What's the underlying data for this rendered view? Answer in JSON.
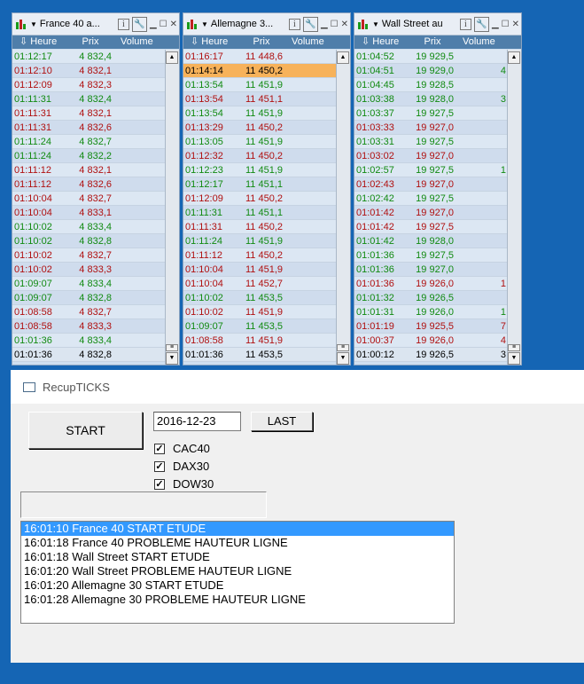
{
  "panels": [
    {
      "title": "France 40 a...",
      "columns": [
        "Heure",
        "Prix",
        "Volume"
      ],
      "rows": [
        {
          "time": "01:12:17",
          "price": "4 832,4",
          "volume": "",
          "dir": "up"
        },
        {
          "time": "01:12:10",
          "price": "4 832,1",
          "volume": "",
          "dir": "down"
        },
        {
          "time": "01:12:09",
          "price": "4 832,3",
          "volume": "",
          "dir": "down"
        },
        {
          "time": "01:11:31",
          "price": "4 832,4",
          "volume": "",
          "dir": "up"
        },
        {
          "time": "01:11:31",
          "price": "4 832,1",
          "volume": "",
          "dir": "down"
        },
        {
          "time": "01:11:31",
          "price": "4 832,6",
          "volume": "",
          "dir": "down"
        },
        {
          "time": "01:11:24",
          "price": "4 832,7",
          "volume": "",
          "dir": "up"
        },
        {
          "time": "01:11:24",
          "price": "4 832,2",
          "volume": "",
          "dir": "up"
        },
        {
          "time": "01:11:12",
          "price": "4 832,1",
          "volume": "",
          "dir": "down"
        },
        {
          "time": "01:11:12",
          "price": "4 832,6",
          "volume": "",
          "dir": "down"
        },
        {
          "time": "01:10:04",
          "price": "4 832,7",
          "volume": "",
          "dir": "down"
        },
        {
          "time": "01:10:04",
          "price": "4 833,1",
          "volume": "",
          "dir": "down"
        },
        {
          "time": "01:10:02",
          "price": "4 833,4",
          "volume": "",
          "dir": "up"
        },
        {
          "time": "01:10:02",
          "price": "4 832,8",
          "volume": "",
          "dir": "up"
        },
        {
          "time": "01:10:02",
          "price": "4 832,7",
          "volume": "",
          "dir": "down"
        },
        {
          "time": "01:10:02",
          "price": "4 833,3",
          "volume": "",
          "dir": "down"
        },
        {
          "time": "01:09:07",
          "price": "4 833,4",
          "volume": "",
          "dir": "up"
        },
        {
          "time": "01:09:07",
          "price": "4 832,8",
          "volume": "",
          "dir": "up"
        },
        {
          "time": "01:08:58",
          "price": "4 832,7",
          "volume": "",
          "dir": "down"
        },
        {
          "time": "01:08:58",
          "price": "4 833,3",
          "volume": "",
          "dir": "down"
        },
        {
          "time": "01:01:36",
          "price": "4 833,4",
          "volume": "",
          "dir": "up"
        },
        {
          "time": "01:01:36",
          "price": "4 832,8",
          "volume": "",
          "dir": "last"
        }
      ]
    },
    {
      "title": "Allemagne 3...",
      "columns": [
        "Heure",
        "Prix",
        "Volume"
      ],
      "rows": [
        {
          "time": "01:16:17",
          "price": "11 448,6",
          "volume": "",
          "dir": "down"
        },
        {
          "time": "01:14:14",
          "price": "11 450,2",
          "volume": "",
          "dir": "sel"
        },
        {
          "time": "01:13:54",
          "price": "11 451,9",
          "volume": "",
          "dir": "up"
        },
        {
          "time": "01:13:54",
          "price": "11 451,1",
          "volume": "",
          "dir": "down"
        },
        {
          "time": "01:13:54",
          "price": "11 451,9",
          "volume": "",
          "dir": "up"
        },
        {
          "time": "01:13:29",
          "price": "11 450,2",
          "volume": "",
          "dir": "down"
        },
        {
          "time": "01:13:05",
          "price": "11 451,9",
          "volume": "",
          "dir": "up"
        },
        {
          "time": "01:12:32",
          "price": "11 450,2",
          "volume": "",
          "dir": "down"
        },
        {
          "time": "01:12:23",
          "price": "11 451,9",
          "volume": "",
          "dir": "up"
        },
        {
          "time": "01:12:17",
          "price": "11 451,1",
          "volume": "",
          "dir": "up"
        },
        {
          "time": "01:12:09",
          "price": "11 450,2",
          "volume": "",
          "dir": "down"
        },
        {
          "time": "01:11:31",
          "price": "11 451,1",
          "volume": "",
          "dir": "up"
        },
        {
          "time": "01:11:31",
          "price": "11 450,2",
          "volume": "",
          "dir": "down"
        },
        {
          "time": "01:11:24",
          "price": "11 451,9",
          "volume": "",
          "dir": "up"
        },
        {
          "time": "01:11:12",
          "price": "11 450,2",
          "volume": "",
          "dir": "down"
        },
        {
          "time": "01:10:04",
          "price": "11 451,9",
          "volume": "",
          "dir": "down"
        },
        {
          "time": "01:10:04",
          "price": "11 452,7",
          "volume": "",
          "dir": "down"
        },
        {
          "time": "01:10:02",
          "price": "11 453,5",
          "volume": "",
          "dir": "up"
        },
        {
          "time": "01:10:02",
          "price": "11 451,9",
          "volume": "",
          "dir": "down"
        },
        {
          "time": "01:09:07",
          "price": "11 453,5",
          "volume": "",
          "dir": "up"
        },
        {
          "time": "01:08:58",
          "price": "11 451,9",
          "volume": "",
          "dir": "down"
        },
        {
          "time": "01:01:36",
          "price": "11 453,5",
          "volume": "",
          "dir": "last"
        }
      ]
    },
    {
      "title": "Wall Street au c...",
      "columns": [
        "Heure",
        "Prix",
        "Volume"
      ],
      "rows": [
        {
          "time": "01:04:52",
          "price": "19 929,5",
          "volume": "",
          "dir": "up"
        },
        {
          "time": "01:04:51",
          "price": "19 929,0",
          "volume": "4",
          "dir": "up"
        },
        {
          "time": "01:04:45",
          "price": "19 928,5",
          "volume": "",
          "dir": "up"
        },
        {
          "time": "01:03:38",
          "price": "19 928,0",
          "volume": "3",
          "dir": "up"
        },
        {
          "time": "01:03:37",
          "price": "19 927,5",
          "volume": "",
          "dir": "up"
        },
        {
          "time": "01:03:33",
          "price": "19 927,0",
          "volume": "",
          "dir": "down"
        },
        {
          "time": "01:03:31",
          "price": "19 927,5",
          "volume": "",
          "dir": "up"
        },
        {
          "time": "01:03:02",
          "price": "19 927,0",
          "volume": "",
          "dir": "down"
        },
        {
          "time": "01:02:57",
          "price": "19 927,5",
          "volume": "1",
          "dir": "up"
        },
        {
          "time": "01:02:43",
          "price": "19 927,0",
          "volume": "",
          "dir": "down"
        },
        {
          "time": "01:02:42",
          "price": "19 927,5",
          "volume": "",
          "dir": "up"
        },
        {
          "time": "01:01:42",
          "price": "19 927,0",
          "volume": "",
          "dir": "down"
        },
        {
          "time": "01:01:42",
          "price": "19 927,5",
          "volume": "",
          "dir": "down"
        },
        {
          "time": "01:01:42",
          "price": "19 928,0",
          "volume": "",
          "dir": "up"
        },
        {
          "time": "01:01:36",
          "price": "19 927,5",
          "volume": "",
          "dir": "up"
        },
        {
          "time": "01:01:36",
          "price": "19 927,0",
          "volume": "",
          "dir": "up"
        },
        {
          "time": "01:01:36",
          "price": "19 926,0",
          "volume": "1",
          "dir": "down"
        },
        {
          "time": "01:01:32",
          "price": "19 926,5",
          "volume": "",
          "dir": "up"
        },
        {
          "time": "01:01:31",
          "price": "19 926,0",
          "volume": "1",
          "dir": "up"
        },
        {
          "time": "01:01:19",
          "price": "19 925,5",
          "volume": "7",
          "dir": "down"
        },
        {
          "time": "01:00:37",
          "price": "19 926,0",
          "volume": "4",
          "dir": "down"
        },
        {
          "time": "01:00:12",
          "price": "19 926,5",
          "volume": "3",
          "dir": "last"
        }
      ]
    }
  ],
  "app": {
    "title": "RecupTICKS",
    "start_label": "START",
    "last_label": "LAST",
    "date_value": "2016-12-23",
    "checkboxes": [
      {
        "label": "CAC40",
        "checked": true
      },
      {
        "label": "DAX30",
        "checked": true
      },
      {
        "label": "DOW30",
        "checked": true
      }
    ],
    "log": [
      "16:01:10 France 40 START ETUDE",
      "16:01:18 France 40 PROBLEME HAUTEUR LIGNE",
      "16:01:18 Wall Street START ETUDE",
      "16:01:20 Wall Street PROBLEME HAUTEUR LIGNE",
      "16:01:20 Allemagne 30 START ETUDE",
      "16:01:28 Allemagne 30 PROBLEME HAUTEUR LIGNE"
    ],
    "log_selected_index": 0
  },
  "colors": {
    "up": "#118a11",
    "down": "#b01010",
    "selected_row": "#f7b25a",
    "list_selection": "#3399ff"
  }
}
